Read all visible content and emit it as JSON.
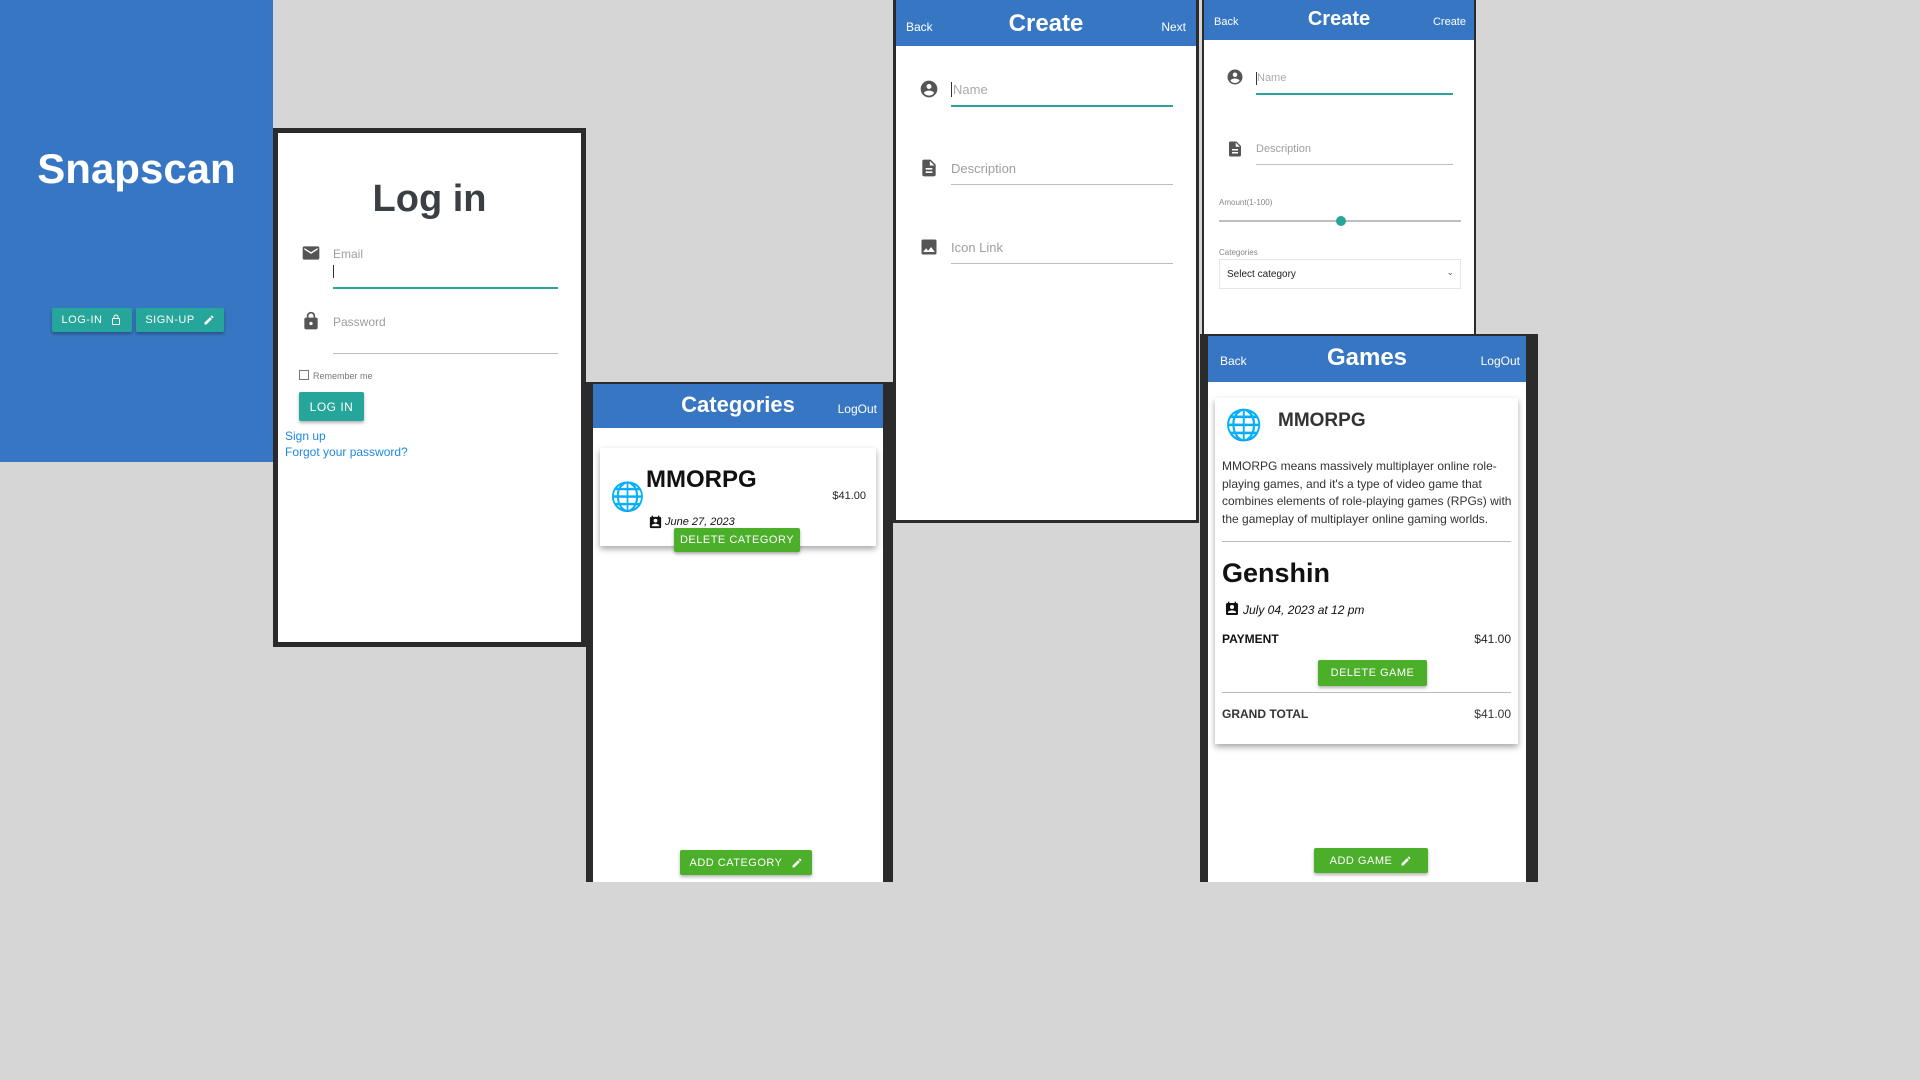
{
  "landing": {
    "app_title": "Snapscan",
    "login_button": "LOG-IN",
    "signup_button": "SIGN-UP"
  },
  "login": {
    "heading": "Log in",
    "email_label": "Email",
    "password_label": "Password",
    "remember_label": "Remember me",
    "submit": "LOG IN",
    "signup_link": "Sign up",
    "forgot_link": "Forgot your password?"
  },
  "categories": {
    "header_title": "Categories",
    "logout": "LogOut",
    "card": {
      "title": "MMORPG",
      "price": "$41.00",
      "date": "June 27, 2023",
      "delete": "DELETE CATEGORY"
    },
    "add": "ADD CATEGORY"
  },
  "create_category": {
    "back": "Back",
    "title": "Create",
    "next": "Next",
    "name_placeholder": "Name",
    "description_placeholder": "Description",
    "icon_placeholder": "Icon Link"
  },
  "create_game": {
    "back": "Back",
    "title": "Create",
    "create": "Create",
    "name_placeholder": "Name",
    "description_placeholder": "Description",
    "amount_label": "Amount(1-100)",
    "amount_value": 50,
    "categories_label": "Categories",
    "select_value": "Select category"
  },
  "games": {
    "back": "Back",
    "title": "Games",
    "logout": "LogOut",
    "category_title": "MMORPG",
    "category_description": "MMORPG means massively multiplayer online role-playing games, and it's a type of video game that combines elements of role-playing games (RPGs) with the gameplay of multiplayer online gaming worlds.",
    "game_title": "Genshin",
    "game_date": "July 04, 2023 at 12 pm",
    "payment_label": "PAYMENT",
    "payment_value": "$41.00",
    "delete": "DELETE GAME",
    "total_label": "GRAND TOTAL",
    "total_value": "$41.00",
    "add": "ADD GAME"
  },
  "colors": {
    "brand_blue": "#3776c2",
    "teal": "#26a69a",
    "green": "#4caf2a",
    "link": "#1e88e5"
  }
}
